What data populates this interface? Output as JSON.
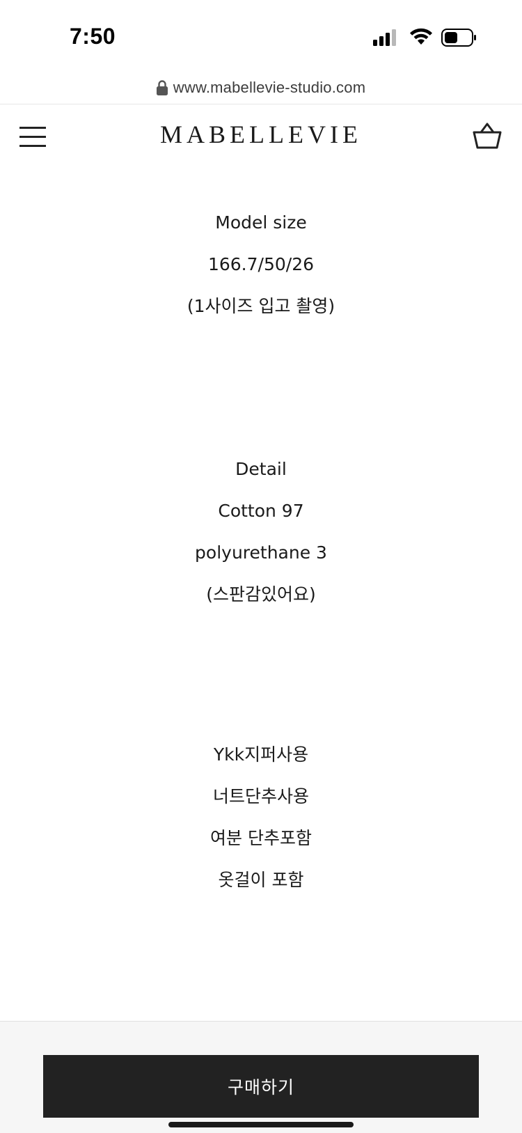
{
  "status_bar": {
    "time": "7:50"
  },
  "browser": {
    "url": "www.mabellevie-studio.com"
  },
  "header": {
    "brand": "MABELLEVIE"
  },
  "content": {
    "model_block": [
      "Model size",
      "166.7/50/26",
      "(1사이즈 입고 촬영)"
    ],
    "detail_block": [
      "Detail",
      "Cotton 97",
      "polyurethane 3",
      "(스판감있어요)"
    ],
    "extras_block": [
      "Ykk지퍼사용",
      "너트단추사용",
      "여분 단추포함",
      "옷걸이 포함"
    ]
  },
  "footer": {
    "buy_label": "구매하기"
  },
  "icons": {
    "menu": "hamburger-icon",
    "cart": "shopping-basket-icon",
    "lock": "lock-icon",
    "signal": "cellular-signal-icon",
    "wifi": "wifi-icon",
    "battery": "battery-icon"
  },
  "colors": {
    "button_bg": "#222222",
    "button_text": "#ffffff",
    "text": "#1a1a1a"
  }
}
